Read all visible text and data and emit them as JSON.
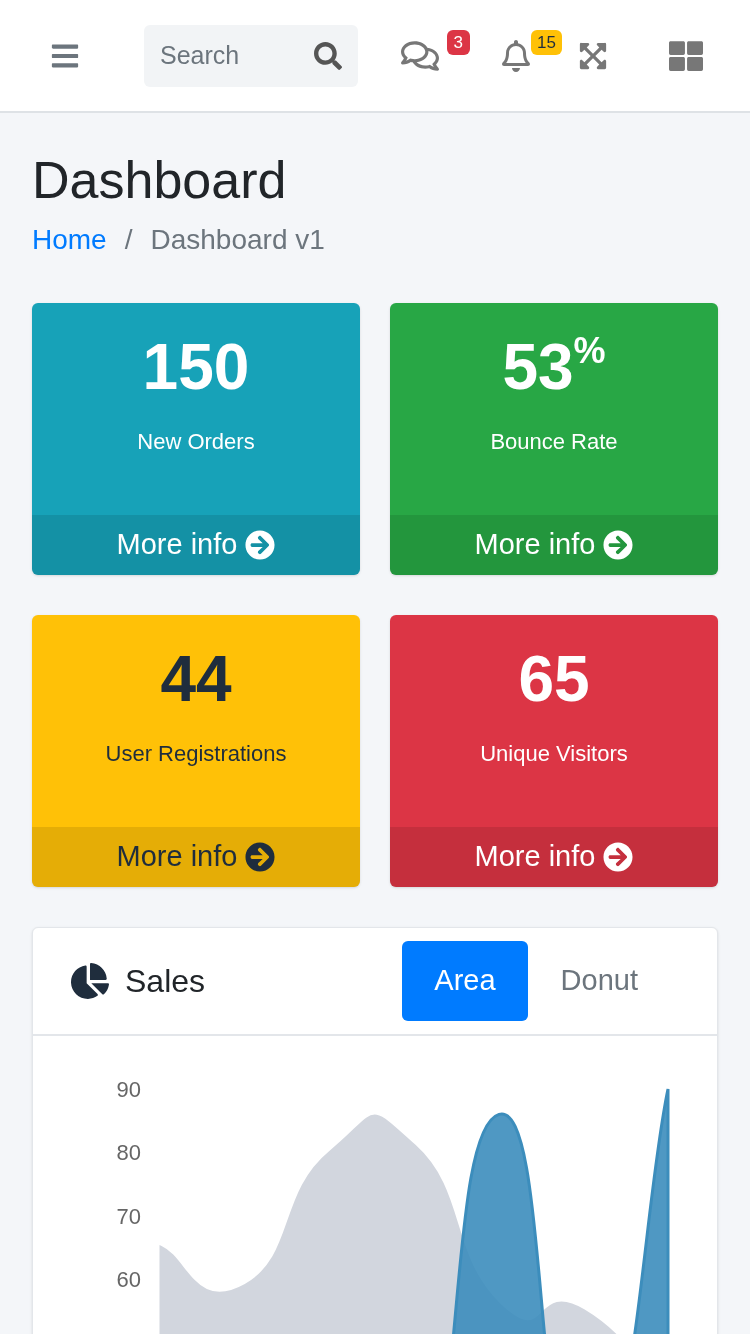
{
  "navbar": {
    "search": {
      "placeholder": "Search"
    },
    "messages_badge": "3",
    "notifications_badge": "15"
  },
  "page": {
    "title": "Dashboard",
    "breadcrumb": [
      {
        "label": "Home",
        "link": true
      },
      {
        "label": "Dashboard v1",
        "link": false
      }
    ],
    "breadcrumb_separator": "/"
  },
  "small_boxes": [
    {
      "value": "150",
      "label": "New Orders",
      "footer": "More info",
      "color": "#17a2b8"
    },
    {
      "value": "53$^{%}$",
      "label": "Bounce Rate",
      "footer": "More info",
      "color": "#28a745"
    },
    {
      "value": "44",
      "label": "User Registrations",
      "footer": "More info",
      "color": "#ffc107"
    },
    {
      "value": "65",
      "label": "Unique Visitors",
      "footer": "More info",
      "color": "#dc3545"
    }
  ],
  "sales_card": {
    "title": "Sales",
    "tabs": [
      {
        "label": "Area",
        "selected": true
      },
      {
        "label": "Donut",
        "selected": false
      }
    ],
    "axis_labels": [
      "90",
      "80",
      "70",
      "60"
    ]
  }
}
